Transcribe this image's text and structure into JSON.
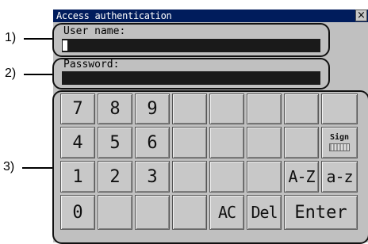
{
  "callouts": {
    "one": "1)",
    "two": "2)",
    "three": "3)"
  },
  "window": {
    "title": "Access authentication",
    "close_glyph": "×"
  },
  "fields": {
    "username_label": "User name:",
    "password_label": "Password:"
  },
  "keypad": {
    "row1": [
      "7",
      "8",
      "9"
    ],
    "row2": [
      "4",
      "5",
      "6"
    ],
    "row3": [
      "1",
      "2",
      "3"
    ],
    "row4": [
      "0"
    ],
    "sign_label": "Sign",
    "upper_label": "A-Z",
    "lower_label": "a-z",
    "ac_label": "AC",
    "del_label": "Del",
    "enter_label": "Enter"
  },
  "colors": {
    "title_bar": "#001c5c",
    "dialog_bg": "#c0c0c0",
    "input_bg": "#1a1a1a"
  },
  "icons": {
    "sign_icon": "keyboard-sign-icon",
    "close_icon": "close-icon"
  }
}
